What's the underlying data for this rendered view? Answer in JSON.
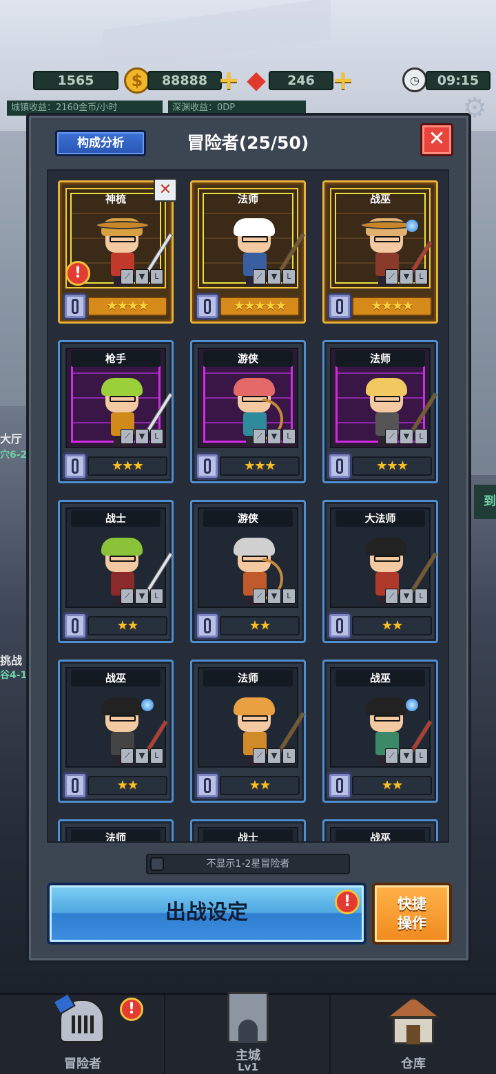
{
  "hud": {
    "energy": "1565",
    "gold": "88888",
    "gems": "246",
    "time": "09:15",
    "town_income": "城镇收益：2160金币/小时",
    "abyss_income": "深渊收益：0DP"
  },
  "side_labels": {
    "hall": "大厅",
    "hall_sub": "穴6-2",
    "challenge": "挑战",
    "challenge_sub": "谷4-1",
    "right_tag": "到"
  },
  "panel": {
    "analysis_button": "构成分析",
    "title": "冒险者(25/50)",
    "close_glyph": "✕"
  },
  "cards": [
    {
      "class": "神梳",
      "stars": "★★★★",
      "rarity": "gold"
    },
    {
      "class": "法师",
      "stars": "★★★★★",
      "rarity": "gold"
    },
    {
      "class": "战巫",
      "stars": "★★★★",
      "rarity": "gold"
    },
    {
      "class": "枪手",
      "stars": "★★★",
      "rarity": "purple"
    },
    {
      "class": "游侠",
      "stars": "★★★",
      "rarity": "purple"
    },
    {
      "class": "法师",
      "stars": "★★★",
      "rarity": "purple"
    },
    {
      "class": "战士",
      "stars": "★★",
      "rarity": "blue"
    },
    {
      "class": "游侠",
      "stars": "★★",
      "rarity": "blue"
    },
    {
      "class": "大法师",
      "stars": "★★",
      "rarity": "blue"
    },
    {
      "class": "战巫",
      "stars": "★★",
      "rarity": "blue"
    },
    {
      "class": "法师",
      "stars": "★★",
      "rarity": "blue"
    },
    {
      "class": "战巫",
      "stars": "★★",
      "rarity": "blue"
    },
    {
      "class": "法师",
      "stars": "",
      "rarity": "blue"
    },
    {
      "class": "战士",
      "stars": "",
      "rarity": "blue"
    },
    {
      "class": "战巫",
      "stars": "",
      "rarity": "blue"
    }
  ],
  "equip_glyphs": [
    "⟋",
    "▼",
    "L"
  ],
  "alert_glyph": "!",
  "swords_glyph": "✕",
  "filter_label": "不显示1-2星冒险者",
  "battle_button": "出战设定",
  "quick_button_line1": "快捷",
  "quick_button_line2": "操作",
  "nav": {
    "adventurer": "冒险者",
    "castle": "主城",
    "castle_level": "Lv1",
    "warehouse": "仓库"
  },
  "colors": {
    "gold_frame": "#e8b13a",
    "purple_frame": "#d22be6",
    "blue_frame": "#4f8fd1",
    "battle_button": "#4ea7e0",
    "quick_button": "#f08a1e"
  }
}
